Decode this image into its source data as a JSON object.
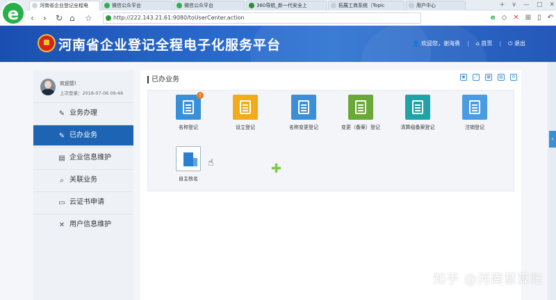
{
  "browser": {
    "logo_letter": "e",
    "tabs": [
      {
        "title": "河南省企业登记全程电",
        "color": "#d0d6de"
      },
      {
        "title": "微信公众平台",
        "color": "#2bb24c"
      },
      {
        "title": "微信公众平台",
        "color": "#2bb24c"
      },
      {
        "title": "360导航_新一代安全上",
        "color": "#2f8f3a"
      },
      {
        "title": "拓展工商系统（Topic",
        "color": "#c4cdd8"
      },
      {
        "title": "用户中心",
        "color": "#c4cdd8"
      }
    ],
    "window_controls": [
      "+",
      "∨",
      "—",
      "□",
      "✕"
    ],
    "url": "http://222.143.21.61:9080/toUserCenter.action",
    "nav": {
      "back": "‹",
      "forward": "›",
      "refresh": "↻",
      "home": "⌂",
      "star": "☆"
    },
    "tools": [
      "e",
      "◇",
      "✕",
      "⊞",
      "▯",
      "↶"
    ]
  },
  "header": {
    "title": "河南省企业登记全程电子化服务平台",
    "user_greeting": "欢迎您，谢海勇",
    "home_label": "首页",
    "logout_label": "退出"
  },
  "sidebar": {
    "welcome": "欢迎您!",
    "last_login": "上次登录：2018-07-06 09:46",
    "items": [
      {
        "label": "业务办理",
        "icon": "✎",
        "active": false
      },
      {
        "label": "已办业务",
        "icon": "✎",
        "active": true
      },
      {
        "label": "企业信息维护",
        "icon": "▤",
        "active": false
      },
      {
        "label": "关联业务",
        "icon": "⌕",
        "active": false
      },
      {
        "label": "云证书申请",
        "icon": "▭",
        "active": false
      },
      {
        "label": "用户信息维护",
        "icon": "✕",
        "active": false
      }
    ]
  },
  "main": {
    "section_title": "已办业务",
    "toolbar_icons": [
      "▣",
      "⤢",
      "▦",
      "▧",
      "⚙"
    ],
    "businesses": [
      {
        "label": "名称登记",
        "color": "#3b8fd6",
        "badge": "!"
      },
      {
        "label": "设立登记",
        "color": "#f2ac1a",
        "badge": ""
      },
      {
        "label": "名称变更登记",
        "color": "#3b8fd6",
        "badge": ""
      },
      {
        "label": "变更（备案）登记",
        "color": "#6aa83a",
        "badge": ""
      },
      {
        "label": "清算组备案登记",
        "color": "#1fa3a8",
        "badge": ""
      },
      {
        "label": "注销登记",
        "color": "#4a9be0",
        "badge": ""
      }
    ],
    "self_naming_label": "自主核名"
  },
  "watermark": "知乎 @河南慧算账"
}
